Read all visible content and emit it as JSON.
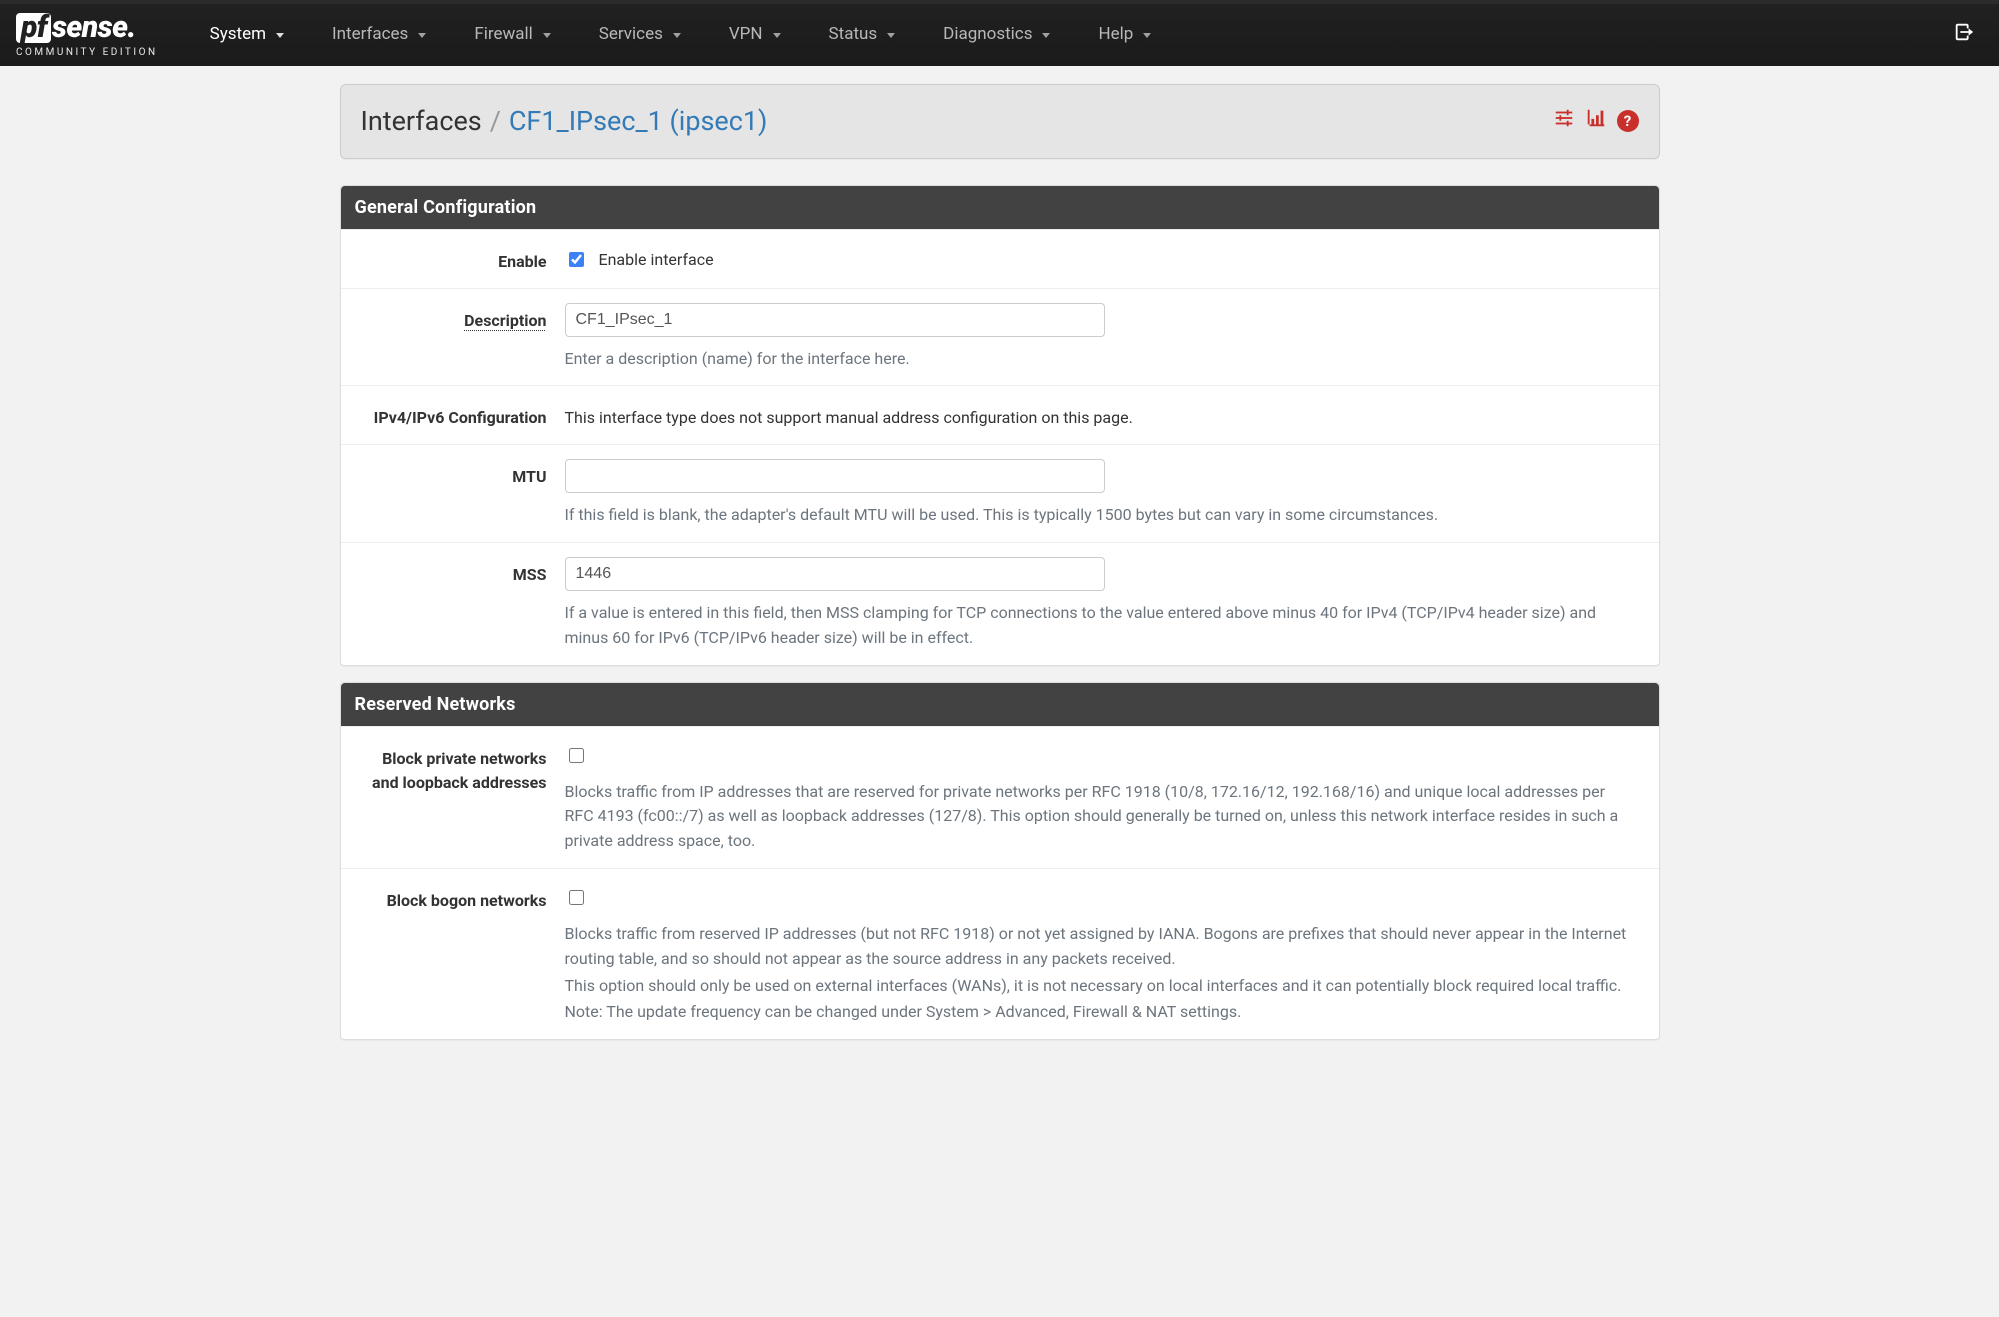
{
  "brand": {
    "logo_prefix": "pf",
    "logo_suffix": "sense",
    "subtitle": "COMMUNITY EDITION"
  },
  "nav": {
    "items": [
      {
        "label": "System",
        "active": true
      },
      {
        "label": "Interfaces",
        "active": false
      },
      {
        "label": "Firewall",
        "active": false
      },
      {
        "label": "Services",
        "active": false
      },
      {
        "label": "VPN",
        "active": false
      },
      {
        "label": "Status",
        "active": false
      },
      {
        "label": "Diagnostics",
        "active": false
      },
      {
        "label": "Help",
        "active": false
      }
    ]
  },
  "header": {
    "section": "Interfaces",
    "separator": "/",
    "page": "CF1_IPsec_1 (ipsec1)",
    "help_symbol": "?"
  },
  "panels": {
    "general": {
      "title": "General Configuration",
      "enable": {
        "label": "Enable",
        "checkbox_label": "Enable interface",
        "checked": true
      },
      "description": {
        "label": "Description",
        "value": "CF1_IPsec_1",
        "help": "Enter a description (name) for the interface here."
      },
      "ipconfig": {
        "label": "IPv4/IPv6 Configuration",
        "text": "This interface type does not support manual address configuration on this page."
      },
      "mtu": {
        "label": "MTU",
        "value": "",
        "help": "If this field is blank, the adapter's default MTU will be used. This is typically 1500 bytes but can vary in some circumstances."
      },
      "mss": {
        "label": "MSS",
        "value": "1446",
        "help": "If a value is entered in this field, then MSS clamping for TCP connections to the value entered above minus 40 for IPv4 (TCP/IPv4 header size) and minus 60 for IPv6 (TCP/IPv6 header size) will be in effect."
      }
    },
    "reserved": {
      "title": "Reserved Networks",
      "block_private": {
        "label": "Block private networks and loopback addresses",
        "checked": false,
        "help": "Blocks traffic from IP addresses that are reserved for private networks per RFC 1918 (10/8, 172.16/12, 192.168/16) and unique local addresses per RFC 4193 (fc00::/7) as well as loopback addresses (127/8). This option should generally be turned on, unless this network interface resides in such a private address space, too."
      },
      "block_bogon": {
        "label": "Block bogon networks",
        "checked": false,
        "help1": "Blocks traffic from reserved IP addresses (but not RFC 1918) or not yet assigned by IANA. Bogons are prefixes that should never appear in the Internet routing table, and so should not appear as the source address in any packets received.",
        "help2": "This option should only be used on external interfaces (WANs), it is not necessary on local interfaces and it can potentially block required local traffic.",
        "help3": "Note: The update frequency can be changed under System > Advanced, Firewall & NAT settings."
      }
    }
  }
}
